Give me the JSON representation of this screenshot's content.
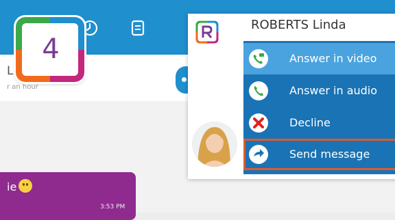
{
  "chat": {
    "name_partial": "L",
    "last_seen_partial": "r an hour",
    "message_text_partial": "ie",
    "message_time": "3:53 PM"
  },
  "app_badge": {
    "number": "4"
  },
  "incoming_call": {
    "caller_name": "ROBERTS Linda",
    "actions": [
      {
        "label": "Answer in video",
        "icon": "video-call-icon"
      },
      {
        "label": "Answer in audio",
        "icon": "phone-icon"
      },
      {
        "label": "Decline",
        "icon": "close-icon"
      },
      {
        "label": "Send message",
        "icon": "arrow-reply-icon"
      }
    ]
  },
  "colors": {
    "topbar": "#1f8fce",
    "menu": "#1a73b4",
    "highlight": "#4aa3de",
    "selection_border": "#e05a2b",
    "message_bubble": "#8f2a8f"
  }
}
